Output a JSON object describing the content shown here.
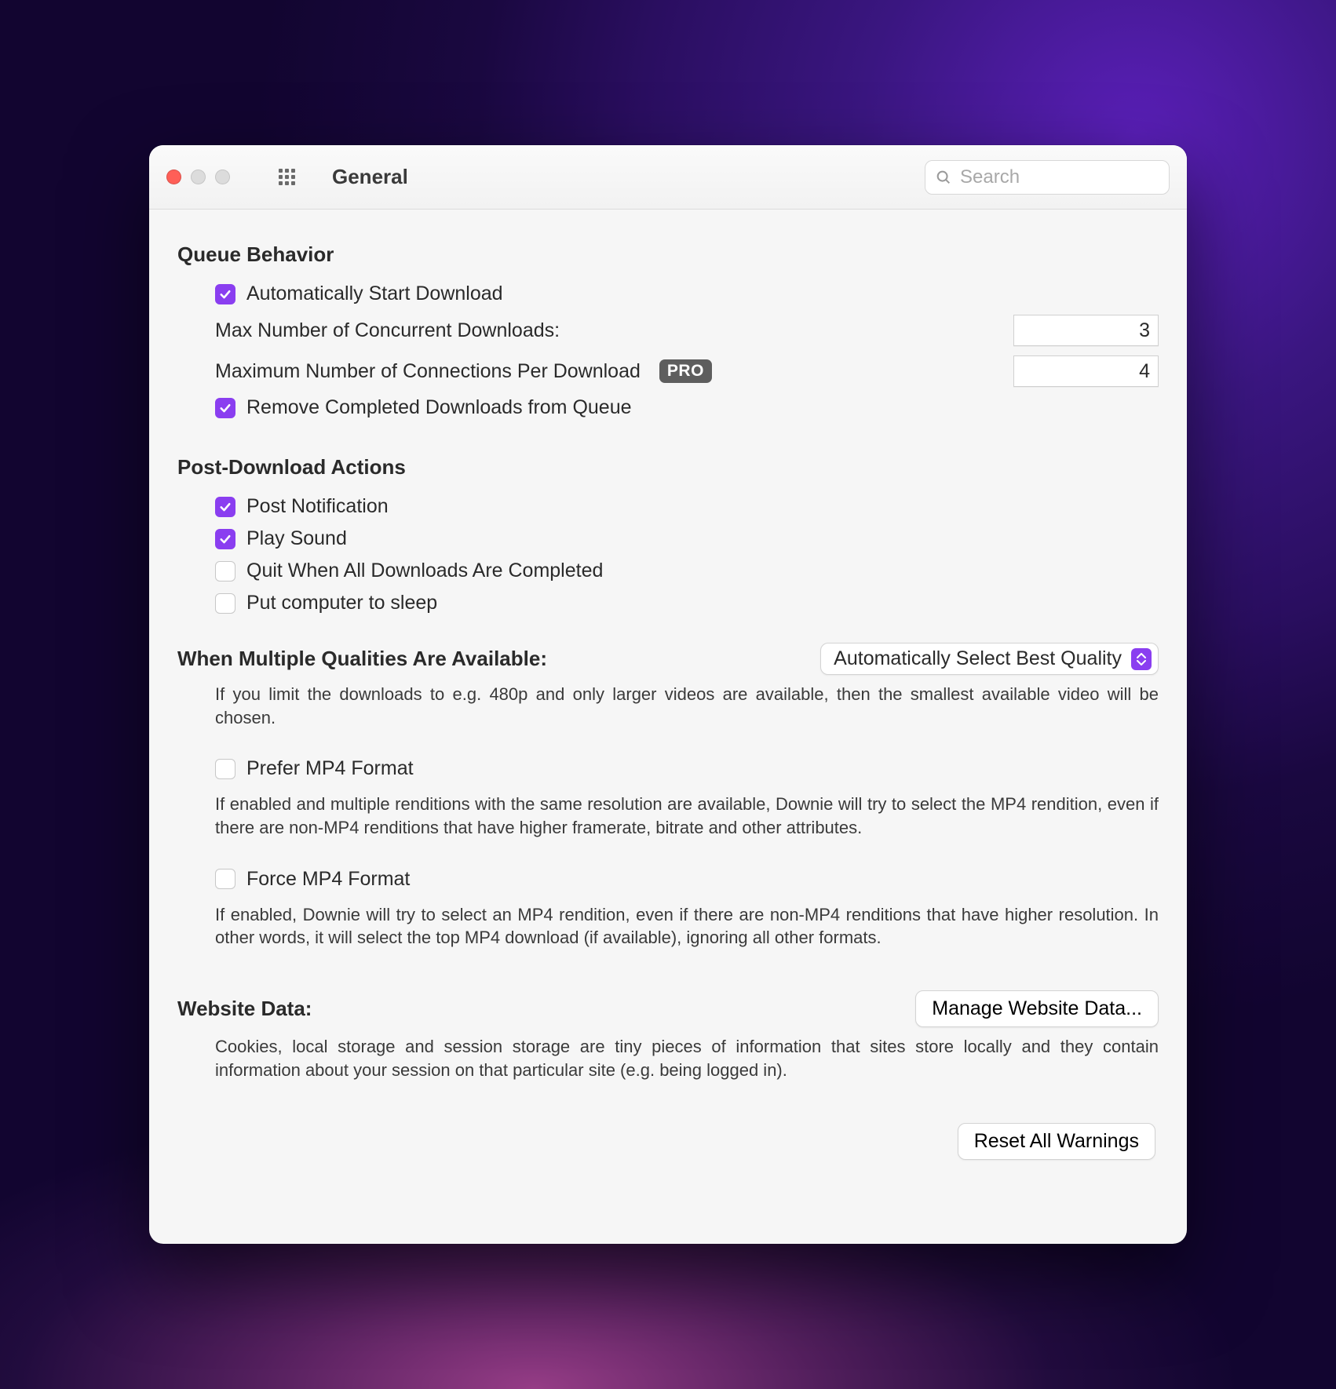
{
  "window": {
    "title": "General",
    "search_placeholder": "Search"
  },
  "queue": {
    "heading": "Queue Behavior",
    "auto_start": {
      "label": "Automatically Start Download",
      "checked": true
    },
    "max_concurrent": {
      "label": "Max Number of Concurrent Downloads:",
      "value": "3"
    },
    "max_connections": {
      "label": "Maximum Number of Connections Per Download",
      "value": "4",
      "pro_badge": "PRO"
    },
    "remove_completed": {
      "label": "Remove Completed Downloads from Queue",
      "checked": true
    }
  },
  "post": {
    "heading": "Post-Download Actions",
    "notify": {
      "label": "Post Notification",
      "checked": true
    },
    "sound": {
      "label": "Play Sound",
      "checked": true
    },
    "quit": {
      "label": "Quit When All Downloads Are Completed",
      "checked": false
    },
    "sleep": {
      "label": "Put computer to sleep",
      "checked": false
    }
  },
  "quality": {
    "heading": "When Multiple Qualities Are Available:",
    "selected": "Automatically Select Best Quality",
    "help": "If you limit the downloads to e.g. 480p and only larger videos are available, then the smallest available video will be chosen.",
    "prefer_mp4": {
      "label": "Prefer MP4 Format",
      "checked": false,
      "help": "If enabled and multiple renditions with the same resolution are available, Downie will try to select the MP4 rendition, even if there are non-MP4 renditions that have higher framerate, bitrate and other attributes."
    },
    "force_mp4": {
      "label": "Force MP4 Format",
      "checked": false,
      "help": "If enabled, Downie will try to select an MP4 rendition, even if there are non-MP4 renditions that have higher resolution. In other words, it will select the top MP4 download (if available), ignoring all other formats."
    }
  },
  "website": {
    "heading": "Website Data:",
    "button": "Manage Website Data...",
    "help": "Cookies, local storage and session storage are tiny pieces of information that sites store locally and they contain information about your session on that particular site (e.g. being logged in)."
  },
  "footer": {
    "reset_button": "Reset All Warnings"
  }
}
